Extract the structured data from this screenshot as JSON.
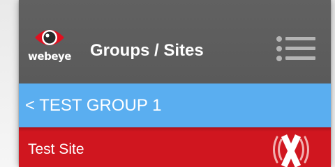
{
  "header": {
    "logo_text": "webeye",
    "title": "Groups / Sites",
    "menu_icon": "hamburger-list-icon",
    "logo_icon": "eye-icon"
  },
  "group": {
    "label": "< TEST GROUP 1"
  },
  "sites": [
    {
      "name": "Test Site",
      "status_icon": "offline-x-icon"
    }
  ],
  "colors": {
    "header_bg": "#5e5e5e",
    "group_bar_bg": "#5aaef0",
    "site_row_bg": "#d0161f",
    "logo_red": "#e01020",
    "text": "#ffffff"
  }
}
